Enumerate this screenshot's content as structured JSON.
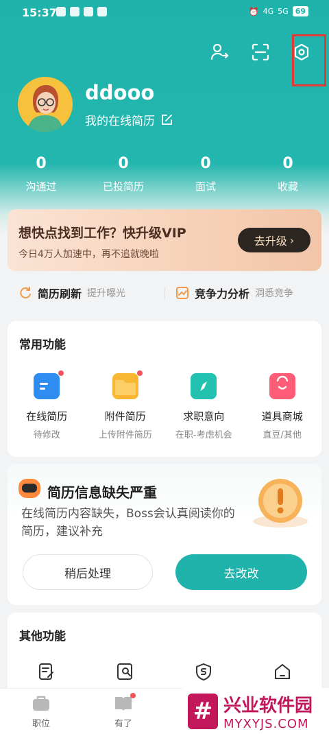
{
  "status_bar": {
    "time": "15:37",
    "network": "4G",
    "network2": "5G",
    "battery": "69"
  },
  "header": {
    "icons": [
      "user-switch-icon",
      "scan-icon",
      "settings-icon"
    ]
  },
  "profile": {
    "username": "ddooo",
    "resume_link": "我的在线简历"
  },
  "stats": [
    {
      "value": "0",
      "label": "沟通过"
    },
    {
      "value": "0",
      "label": "已投简历"
    },
    {
      "value": "0",
      "label": "面试"
    },
    {
      "value": "0",
      "label": "收藏"
    }
  ],
  "vip_banner": {
    "title": "想快点找到工作？快升级VIP",
    "subtitle": "今日4万人加速中，再不追就晚啦",
    "button": "去升级"
  },
  "quick_actions": [
    {
      "label": "简历刷新",
      "hint": "提升曝光"
    },
    {
      "label": "竞争力分析",
      "hint": "洞悉竞争"
    }
  ],
  "common_functions": {
    "title": "常用功能",
    "items": [
      {
        "name": "在线简历",
        "sub": "待修改",
        "color": "#2f8cf0",
        "badge": true
      },
      {
        "name": "附件简历",
        "sub": "上传附件简历",
        "color": "#f8b632",
        "badge": true
      },
      {
        "name": "求职意向",
        "sub": "在职-考虑机会",
        "color": "#22c1b0",
        "badge": false
      },
      {
        "name": "道具商城",
        "sub": "直豆/其他",
        "color": "#ff5c78",
        "badge": false
      }
    ]
  },
  "missing_card": {
    "title": "简历信息缺失严重",
    "description": "在线简历内容缺失，Boss会认真阅读你的简历，建议补充",
    "later_button": "稍后处理",
    "fix_button": "去改改"
  },
  "other_functions": {
    "title": "其他功能"
  },
  "tabbar": {
    "jobs": "职位",
    "you": "有了"
  },
  "watermark": {
    "title": "兴业软件园",
    "url": "MYXYJS.COM"
  },
  "colors": {
    "accent": "#1fb3ac",
    "vip_button": "#2b2622"
  }
}
